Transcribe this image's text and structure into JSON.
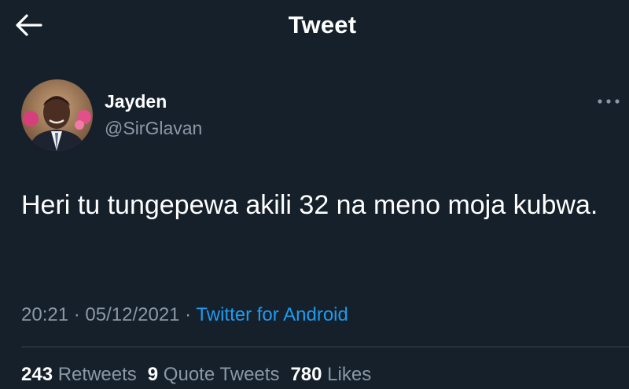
{
  "header": {
    "title": "Tweet",
    "back_icon": "arrow-left-icon"
  },
  "author": {
    "name": "Jayden",
    "handle": "@SirGlavan",
    "avatar": "profile-photo"
  },
  "more_icon": "more-horizontal-icon",
  "tweet": {
    "text": "Heri tu tungepewa akili 32 na meno moja kubwa.",
    "time": "20:21",
    "date": "05/12/2021",
    "separator": " · ",
    "source": "Twitter for Android"
  },
  "stats": {
    "retweets_count": "243",
    "retweets_label": "Retweets",
    "quotes_count": "9",
    "quotes_label": "Quote Tweets",
    "likes_count": "780",
    "likes_label": "Likes"
  },
  "colors": {
    "background": "#15202b",
    "text": "#ffffff",
    "muted": "#8b98a5",
    "link": "#1d9bf0",
    "divider": "#38444d"
  }
}
